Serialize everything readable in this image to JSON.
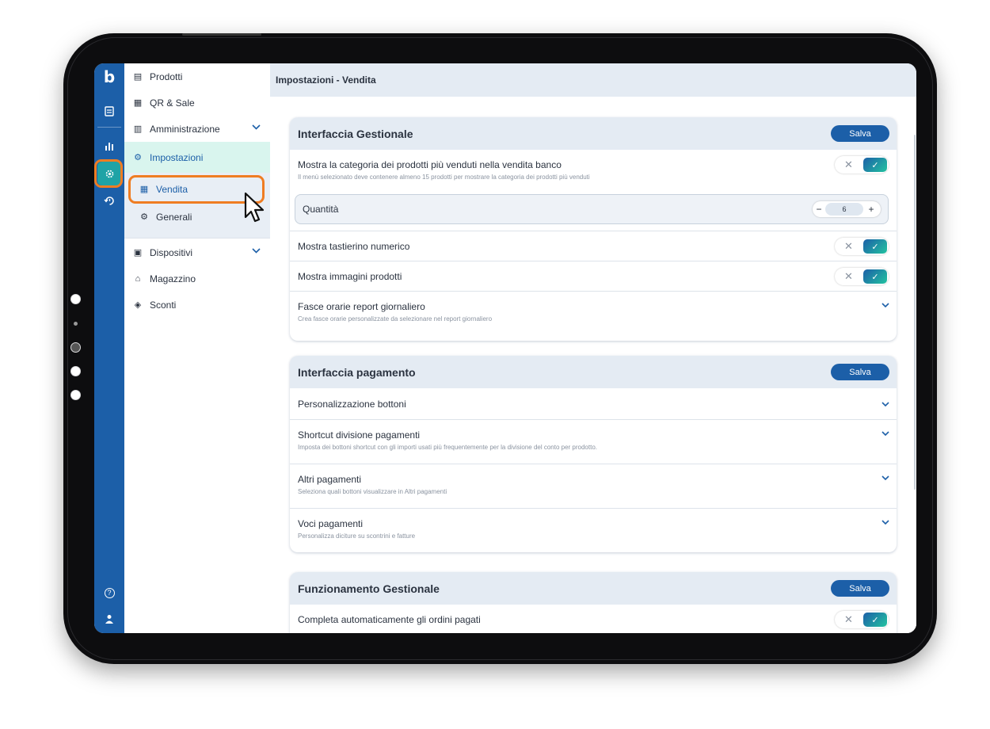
{
  "rail": {
    "logo": "b",
    "icons": [
      "receipt-icon",
      "bar-chart-icon",
      "gear-icon",
      "history-icon",
      "help-icon",
      "user-icon"
    ],
    "help_glyph": "?",
    "user_glyph": "●"
  },
  "nav": {
    "items": [
      {
        "label": "Prodotti",
        "icon": "menu-book-icon",
        "glyph": "▤"
      },
      {
        "label": "QR & Sale",
        "icon": "qr-code-icon",
        "glyph": "▦"
      },
      {
        "label": "Amministrazione",
        "icon": "calendar-icon",
        "glyph": "▥"
      },
      {
        "label": "Impostazioni",
        "icon": "settings-box-icon",
        "glyph": "⚙"
      },
      {
        "label": "Dispositivi",
        "icon": "devices-icon",
        "glyph": "▣"
      },
      {
        "label": "Magazzino",
        "icon": "warehouse-icon",
        "glyph": "⌂"
      },
      {
        "label": "Sconti",
        "icon": "tag-icon",
        "glyph": "◈"
      }
    ],
    "subitems": [
      {
        "label": "Vendita",
        "icon": "register-icon",
        "glyph": "▦"
      },
      {
        "label": "Generali",
        "icon": "gear-icon",
        "glyph": "⚙"
      }
    ],
    "chevron": "⌄"
  },
  "header": {
    "title": "Impostazioni - Vendita"
  },
  "cards": {
    "gestionale": {
      "title": "Interfaccia Gestionale",
      "save_label": "Salva",
      "rows": {
        "categoria_title": "Mostra la categoria dei prodotti più venduti nella vendita banco",
        "categoria_desc": "Il menù selezionato deve contenere almeno 15 prodotti per mostrare la categoria dei prodotti più venduti",
        "quantita_label": "Quantità",
        "quantita_value": "6",
        "minus": "−",
        "plus": "+",
        "tastierino_title": "Mostra tastierino numerico",
        "immagini_title": "Mostra immagini prodotti",
        "fasce_title": "Fasce orarie report giornaliero",
        "fasce_desc": "Crea fasce orarie personalizzate da selezionare nel report giornaliero"
      }
    },
    "pagamento": {
      "title": "Interfaccia pagamento",
      "save_label": "Salva",
      "rows": {
        "bottoni_title": "Personalizzazione bottoni",
        "shortcut_title": "Shortcut divisione pagamenti",
        "shortcut_desc": "Imposta dei bottoni shortcut con gli importi usati più frequentemente per la divisione del conto per prodotto.",
        "altri_title": "Altri pagamenti",
        "altri_desc": "Seleziona quali bottoni visualizzare in Altri pagamenti",
        "voci_title": "Voci pagamenti",
        "voci_desc": "Personalizza diciture su scontrini e fatture"
      }
    },
    "funzionamento": {
      "title": "Funzionamento Gestionale",
      "save_label": "Salva",
      "rows": {
        "completa_title": "Completa automaticamente gli ordini pagati"
      }
    }
  },
  "toggle": {
    "off_glyph": "✕",
    "on_glyph": "✓"
  },
  "colors": {
    "primary": "#1c5fa8",
    "accent_teal": "#22c3a0",
    "highlight": "#ef7d22",
    "nav_active_bg": "#d9f5ee"
  }
}
